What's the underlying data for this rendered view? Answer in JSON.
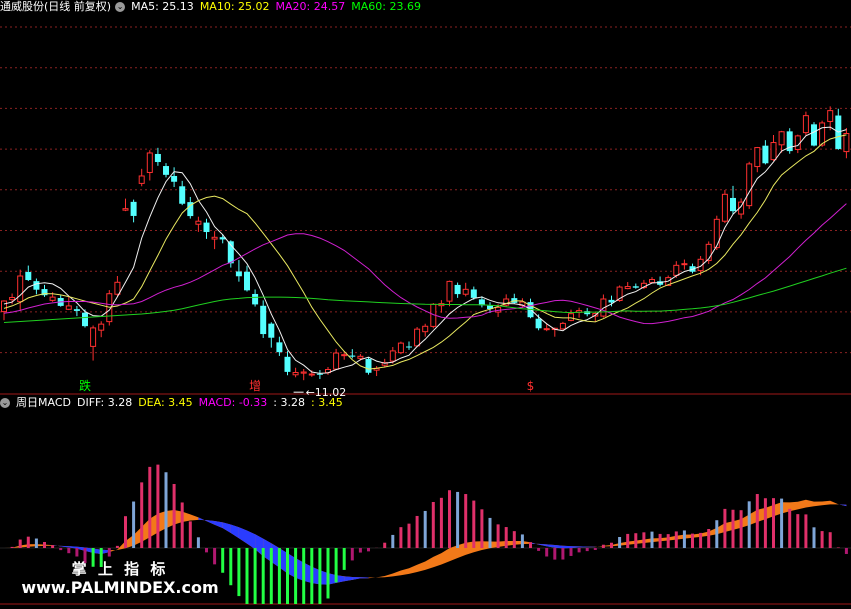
{
  "main_header": {
    "title": "通威股份(日线 前复权)",
    "ma5": "MA5: 25.13",
    "ma10": "MA10: 25.02",
    "ma20": "MA20: 24.57",
    "ma60": "MA60: 23.69",
    "colors": {
      "ma5": "#ffffff",
      "ma10": "#ffff00",
      "ma20": "#ff00ff",
      "ma60": "#00ff00"
    }
  },
  "macd_header": {
    "title": "周日MACD",
    "diff": "DIFF: 3.28",
    "dea": "DEA: 3.45",
    "macd": "MACD: -0.33",
    "extra1": ": 3.28",
    "extra2": ": 3.45"
  },
  "watermark": {
    "line1": "掌 上 指 标",
    "line2": "www.PALMINDEX.com"
  },
  "chart_data": [
    {
      "type": "candlestick",
      "title": "通威股份(日线 前复权)",
      "signals": [
        {
          "text": "跌",
          "color": "#00ff00",
          "bar": 10
        },
        {
          "text": "增",
          "color": "#ff3030",
          "bar": 31
        },
        {
          "text": "$",
          "color": "#ff3030",
          "bar": 65
        }
      ],
      "low_annotation": {
        "text": "11.02",
        "bar": 36
      },
      "price_range": [
        10,
        40
      ],
      "candles": [
        [
          16.48,
          17.38,
          15.79,
          17.32
        ],
        [
          17.43,
          17.92,
          17.06,
          17.6
        ],
        [
          17.27,
          19.82,
          16.53,
          19.31
        ],
        [
          19.63,
          20.14,
          18.91,
          18.99
        ],
        [
          18.9,
          19.11,
          17.85,
          18.22
        ],
        [
          18.27,
          18.6,
          17.65,
          17.78
        ],
        [
          17.37,
          18.02,
          17.26,
          17.63
        ],
        [
          17.56,
          17.82,
          16.87,
          16.93
        ],
        [
          16.66,
          17.72,
          16.6,
          16.93
        ],
        [
          16.67,
          16.93,
          16.12,
          16.53
        ],
        [
          16.39,
          16.65,
          15.21,
          15.32
        ],
        [
          13.71,
          15.37,
          12.58,
          15.18
        ],
        [
          15.0,
          15.71,
          14.44,
          15.48
        ],
        [
          15.68,
          18.19,
          15.37,
          17.9
        ],
        [
          17.86,
          19.31,
          17.69,
          18.81
        ],
        [
          24.55,
          25.47,
          24.47,
          24.67
        ],
        [
          25.21,
          25.39,
          23.58,
          24.09
        ],
        [
          26.68,
          27.84,
          26.45,
          27.27
        ],
        [
          27.55,
          29.32,
          26.91,
          29.1
        ],
        [
          29.02,
          29.51,
          28.08,
          28.38
        ],
        [
          28.06,
          28.29,
          27.16,
          27.36
        ],
        [
          27.27,
          27.96,
          26.39,
          26.81
        ],
        [
          26.45,
          26.88,
          24.95,
          25.06
        ],
        [
          25.19,
          25.6,
          23.88,
          24.08
        ],
        [
          23.43,
          24.03,
          22.82,
          23.67
        ],
        [
          23.56,
          23.87,
          22.26,
          22.81
        ],
        [
          22.25,
          22.88,
          21.45,
          22.39
        ],
        [
          22.4,
          22.63,
          21.91,
          22.22
        ],
        [
          22.07,
          22.15,
          19.98,
          20.32
        ],
        [
          19.67,
          20.58,
          18.86,
          19.29
        ],
        [
          19.65,
          20.13,
          18.08,
          18.17
        ],
        [
          17.88,
          18.24,
          16.88,
          17.05
        ],
        [
          16.94,
          17.37,
          14.38,
          14.69
        ],
        [
          15.52,
          15.63,
          13.61,
          14.4
        ],
        [
          14.03,
          14.48,
          12.95,
          13.25
        ],
        [
          12.88,
          13.33,
          11.41,
          11.68
        ],
        [
          11.45,
          12.01,
          11.25,
          11.63
        ],
        [
          11.58,
          11.91,
          11.02,
          11.67
        ],
        [
          11.49,
          11.81,
          11.29,
          11.51
        ],
        [
          11.53,
          11.83,
          11.11,
          11.5
        ],
        [
          11.62,
          12.07,
          11.44,
          11.87
        ],
        [
          11.9,
          13.51,
          11.84,
          13.18
        ],
        [
          12.97,
          13.3,
          12.65,
          13.05
        ],
        [
          12.98,
          13.49,
          12.75,
          12.89
        ],
        [
          12.76,
          13.1,
          12.58,
          12.92
        ],
        [
          12.71,
          12.86,
          11.46,
          11.61
        ],
        [
          11.82,
          12.14,
          11.35,
          11.96
        ],
        [
          12.21,
          12.72,
          12.02,
          12.42
        ],
        [
          12.54,
          13.66,
          12.33,
          13.35
        ],
        [
          13.21,
          14.09,
          13.09,
          13.97
        ],
        [
          13.7,
          14.1,
          13.43,
          13.62
        ],
        [
          13.75,
          15.25,
          13.64,
          15.08
        ],
        [
          14.88,
          15.51,
          14.48,
          15.31
        ],
        [
          15.3,
          17.16,
          15.15,
          17.06
        ],
        [
          16.95,
          17.39,
          16.39,
          17.11
        ],
        [
          17.31,
          18.94,
          16.9,
          18.88
        ],
        [
          18.6,
          18.79,
          17.57,
          17.87
        ],
        [
          17.86,
          18.77,
          17.69,
          18.25
        ],
        [
          18.24,
          18.47,
          17.42,
          17.57
        ],
        [
          17.45,
          17.7,
          16.81,
          16.98
        ],
        [
          16.95,
          17.22,
          16.37,
          16.68
        ],
        [
          16.44,
          17.07,
          16.05,
          16.81
        ],
        [
          16.99,
          17.85,
          16.86,
          17.48
        ],
        [
          17.55,
          17.9,
          17.12,
          17.17
        ],
        [
          16.97,
          17.54,
          16.77,
          17.24
        ],
        [
          17.23,
          17.51,
          15.95,
          16.03
        ],
        [
          15.91,
          16.25,
          14.99,
          15.15
        ],
        [
          15.05,
          15.49,
          14.92,
          15.12
        ],
        [
          15.05,
          15.21,
          14.48,
          15.15
        ],
        [
          15.1,
          15.66,
          15.03,
          15.54
        ],
        [
          15.78,
          16.63,
          15.71,
          16.31
        ],
        [
          16.42,
          16.79,
          15.99,
          16.56
        ],
        [
          16.51,
          16.76,
          16.1,
          16.27
        ],
        [
          16.12,
          16.46,
          15.69,
          16.32
        ],
        [
          16.12,
          17.84,
          16.0,
          17.48
        ],
        [
          17.41,
          17.75,
          16.89,
          17.2
        ],
        [
          17.36,
          18.56,
          17.26,
          18.43
        ],
        [
          18.31,
          18.83,
          18.26,
          18.47
        ],
        [
          18.49,
          18.71,
          18.3,
          18.38
        ],
        [
          18.39,
          19.0,
          18.27,
          18.73
        ],
        [
          18.8,
          19.22,
          18.72,
          19.03
        ],
        [
          18.89,
          19.27,
          18.48,
          18.61
        ],
        [
          18.56,
          19.35,
          18.53,
          19.18
        ],
        [
          19.36,
          20.49,
          19.16,
          20.16
        ],
        [
          20.25,
          20.62,
          19.82,
          20.29
        ],
        [
          20.09,
          20.3,
          19.52,
          19.65
        ],
        [
          19.74,
          20.9,
          19.37,
          20.64
        ],
        [
          20.54,
          22.06,
          20.27,
          21.83
        ],
        [
          21.57,
          24.11,
          21.38,
          23.82
        ],
        [
          23.67,
          26.15,
          23.52,
          25.81
        ],
        [
          25.52,
          26.48,
          24.24,
          24.47
        ],
        [
          24.24,
          25.49,
          23.87,
          25.19
        ],
        [
          24.91,
          28.4,
          24.65,
          28.23
        ],
        [
          28.02,
          29.58,
          27.57,
          29.53
        ],
        [
          29.68,
          30.12,
          28.19,
          28.28
        ],
        [
          28.57,
          30.53,
          28.45,
          29.93
        ],
        [
          29.75,
          30.86,
          29.12,
          30.79
        ],
        [
          30.82,
          31.07,
          29.04,
          29.25
        ],
        [
          29.38,
          30.56,
          29.09,
          30.46
        ],
        [
          30.72,
          32.39,
          30.49,
          32.07
        ],
        [
          31.38,
          31.56,
          29.63,
          29.69
        ],
        [
          29.73,
          31.67,
          29.59,
          31.49
        ],
        [
          31.61,
          32.81,
          30.91,
          32.47
        ],
        [
          32.08,
          32.62,
          29.35,
          29.42
        ],
        [
          29.21,
          31.09,
          28.68,
          30.65
        ]
      ],
      "ma_lines": {
        "MA5": [
          17.08,
          17.23,
          17.78,
          18.43,
          18.69,
          18.78,
          18.68,
          18.32,
          17.71,
          17.17,
          16.48,
          16.16,
          16.11,
          16.59,
          17.66,
          18.81,
          20.0,
          22.33,
          24.01,
          25.53,
          26.82,
          27.61,
          27.53,
          26.65,
          25.33,
          24.4,
          23.24,
          22.6,
          21.77,
          21.07,
          20.29,
          19.17,
          17.78,
          16.28,
          14.98,
          13.45,
          12.6,
          12.21,
          11.67,
          11.56,
          11.6,
          11.86,
          12.05,
          12.23,
          12.65,
          12.85,
          12.54,
          12.37,
          12.46,
          12.78,
          13.01,
          13.7,
          14.27,
          14.96,
          15.62,
          16.3,
          16.8,
          17.18,
          17.53,
          17.64,
          17.38,
          17.18,
          17.12,
          17.1,
          17.0,
          16.67,
          16.05,
          15.51,
          15.07,
          14.96,
          15.38,
          15.66,
          15.83,
          16.18,
          16.76,
          17.08,
          17.51,
          17.87,
          18.07,
          18.44,
          18.75,
          18.79,
          18.9,
          19.33,
          19.67,
          19.84,
          20.08,
          20.67,
          21.71,
          23.17,
          24.22,
          24.85,
          25.99,
          27.07,
          27.61,
          28.38,
          29.26,
          29.56,
          29.69,
          30.47,
          30.77,
          31.1,
          31.16,
          30.76,
          30.96
        ],
        "MA10": [
          16.73,
          16.93,
          17.21,
          17.57,
          17.76,
          17.91,
          17.89,
          17.81,
          17.67,
          17.5,
          17.31,
          17.15,
          16.99,
          16.83,
          16.92,
          17.16,
          17.48,
          18.46,
          19.72,
          20.95,
          22.24,
          23.32,
          24.32,
          24.93,
          25.3,
          25.56,
          25.67,
          25.47,
          25.02,
          24.6,
          24.27,
          23.53,
          22.71,
          21.87,
          21.03,
          20.13,
          19.06,
          17.99,
          16.83,
          15.86,
          14.96,
          14.06,
          13.31,
          12.64,
          12.16,
          11.9,
          11.97,
          12.07,
          12.2,
          12.47,
          12.67,
          12.98,
          13.3,
          13.63,
          14.05,
          14.54,
          15.11,
          15.65,
          16.25,
          16.48,
          16.67,
          16.88,
          17.12,
          17.34,
          17.32,
          16.96,
          16.65,
          16.32,
          16.03,
          15.98,
          15.98,
          15.83,
          15.71,
          15.66,
          15.91,
          16.23,
          16.5,
          16.77,
          17.16,
          17.51,
          17.96,
          18.35,
          18.62,
          18.84,
          19.08,
          19.32,
          19.53,
          19.84,
          20.31,
          20.98,
          21.84,
          22.6,
          23.52,
          24.37,
          25.37,
          26.52,
          27.35,
          27.87,
          28.38,
          28.87,
          29.23,
          29.84,
          30.21,
          30.4,
          30.54
        ],
        "MA20": [
          16.34,
          16.44,
          16.57,
          16.76,
          16.92,
          17.08,
          17.17,
          17.25,
          17.28,
          17.29,
          17.28,
          17.23,
          17.14,
          17.04,
          17.01,
          17.06,
          17.11,
          17.28,
          17.58,
          17.91,
          18.19,
          18.41,
          18.59,
          18.82,
          19.1,
          19.45,
          19.8,
          20.16,
          20.39,
          20.75,
          21.11,
          21.47,
          21.79,
          22.04,
          22.3,
          22.57,
          22.67,
          22.68,
          22.53,
          22.33,
          22.04,
          21.71,
          21.35,
          20.86,
          20.38,
          19.89,
          19.24,
          18.62,
          18.08,
          17.59,
          17.19,
          16.84,
          16.54,
          16.24,
          16.03,
          15.95,
          15.97,
          16.03,
          16.07,
          16.19,
          16.47,
          16.57,
          16.65,
          16.72,
          16.82,
          16.95,
          17.09,
          17.21,
          17.35,
          17.38,
          17.3,
          17.14,
          16.96,
          16.77,
          16.58,
          16.33,
          16.04,
          15.85,
          15.68,
          15.53,
          15.52,
          15.6,
          15.7,
          15.84,
          15.99,
          16.09,
          16.29,
          16.5,
          16.86,
          17.18,
          17.44,
          17.82,
          18.24,
          18.72,
          19.16,
          19.73,
          20.3,
          20.86,
          21.52,
          22.15,
          22.73,
          23.36,
          23.91,
          24.49,
          25.07
        ],
        "MA60": [
          15.61,
          15.65,
          15.69,
          15.73,
          15.77,
          15.81,
          15.85,
          15.89,
          15.93,
          15.97,
          16.01,
          16.05,
          16.09,
          16.13,
          16.17,
          16.21,
          16.25,
          16.29,
          16.34,
          16.41,
          16.49,
          16.59,
          16.71,
          16.85,
          17.0,
          17.14,
          17.28,
          17.4,
          17.48,
          17.53,
          17.59,
          17.61,
          17.63,
          17.63,
          17.63,
          17.62,
          17.6,
          17.57,
          17.53,
          17.48,
          17.42,
          17.38,
          17.34,
          17.31,
          17.28,
          17.25,
          17.21,
          17.18,
          17.15,
          17.12,
          17.1,
          17.08,
          17.06,
          17.05,
          17.05,
          17.04,
          17.04,
          17.03,
          17.03,
          17.02,
          16.99,
          16.94,
          16.86,
          16.78,
          16.71,
          16.65,
          16.58,
          16.53,
          16.48,
          16.42,
          16.4,
          16.42,
          16.44,
          16.44,
          16.45,
          16.48,
          16.52,
          16.53,
          16.51,
          16.51,
          16.52,
          16.52,
          16.56,
          16.6,
          16.65,
          16.7,
          16.76,
          16.84,
          16.95,
          17.06,
          17.22,
          17.39,
          17.57,
          17.76,
          17.93,
          18.11,
          18.31,
          18.51,
          18.71,
          18.91,
          19.12,
          19.32,
          19.53,
          19.73,
          19.93
        ]
      }
    },
    {
      "type": "bar",
      "title": "周日MACD",
      "series": [
        {
          "name": "DIFF",
          "value": 3.28
        },
        {
          "name": "DEA",
          "value": 3.45
        },
        {
          "name": "MACD",
          "value": -0.33
        }
      ]
    }
  ]
}
